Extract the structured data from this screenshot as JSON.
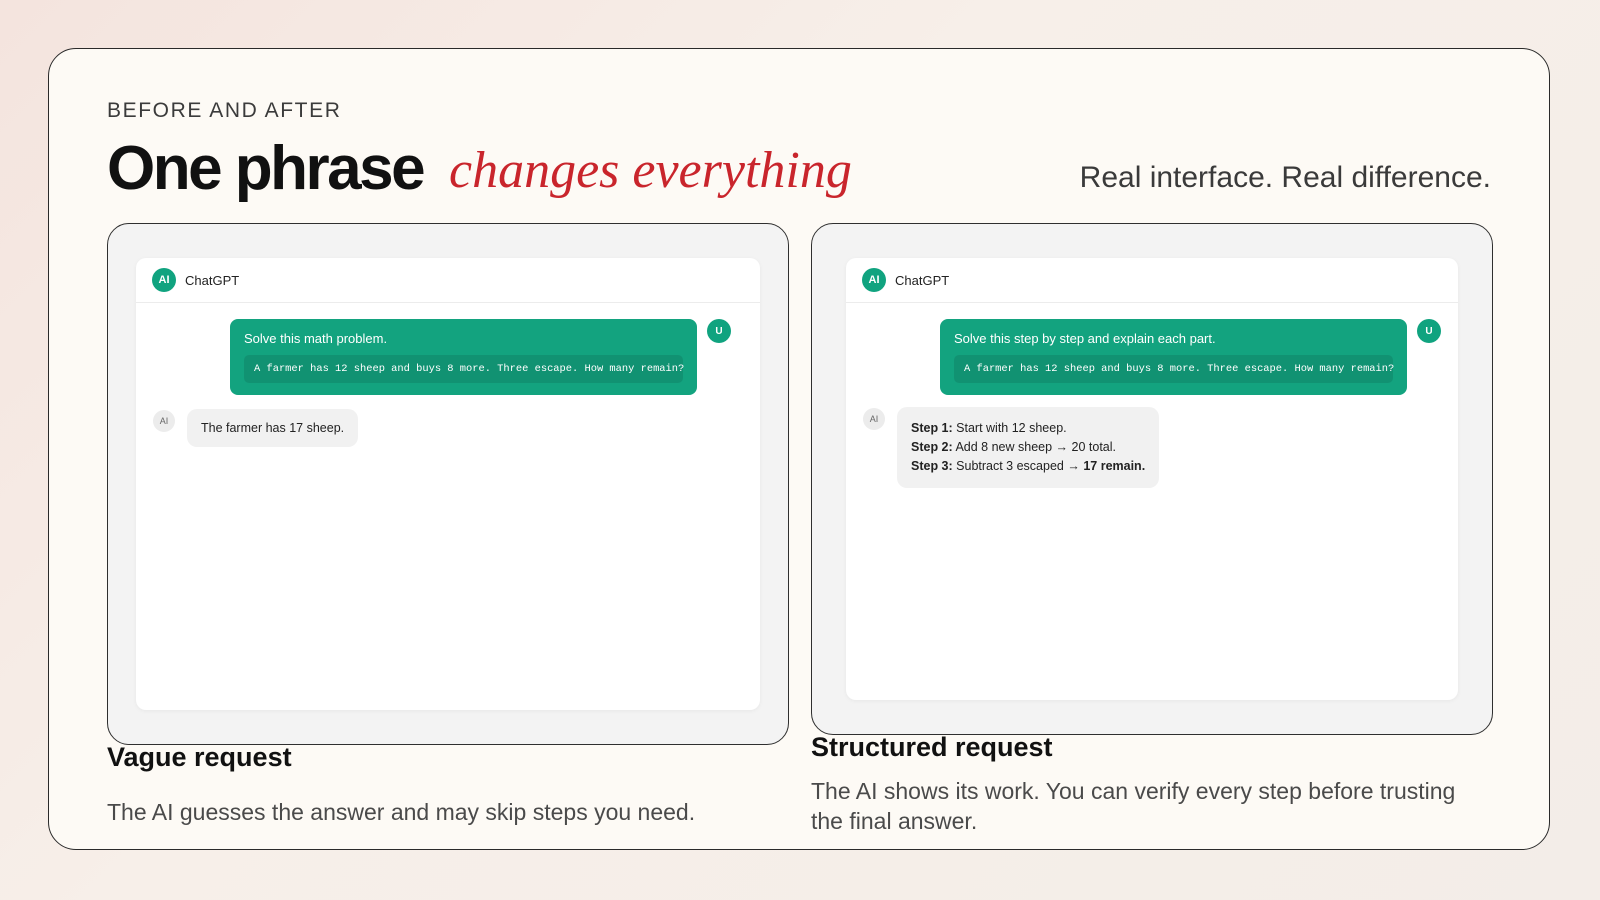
{
  "eyebrow": "BEFORE AND AFTER",
  "title": {
    "main": "One phrase",
    "accent": "changes everything",
    "subtitle": "Real interface. Real difference."
  },
  "colors": {
    "accent_red": "#c9252c",
    "brand_green": "#10a37f"
  },
  "left": {
    "chat_name": "ChatGPT",
    "ai_logo": "AI",
    "user_avatar": "U",
    "ai_avatar": "AI",
    "user_message": "Solve this math problem.",
    "user_code": "A farmer has 12 sheep and buys 8 more. Three escape. How many remain?",
    "ai_reply": "The farmer has 17 sheep.",
    "caption_title": "Vague request",
    "caption_text": "The AI guesses the answer and may skip steps you need."
  },
  "right": {
    "chat_name": "ChatGPT",
    "ai_logo": "AI",
    "user_avatar": "U",
    "ai_avatar": "AI",
    "user_message": "Solve this step by step and explain each part.",
    "user_code": "A farmer has 12 sheep and buys 8 more. Three escape. How many remain?",
    "steps": [
      {
        "label": "Step 1:",
        "text": " Start with 12 sheep.",
        "bold_tail": ""
      },
      {
        "label": "Step 2:",
        "text": " Add 8 new sheep → 20 total.",
        "bold_tail": ""
      },
      {
        "label": "Step 3:",
        "text": " Subtract 3 escaped → ",
        "bold_tail": "17 remain."
      }
    ],
    "caption_title": "Structured request",
    "caption_text": "The AI shows its work. You can verify every step before trusting the final answer."
  }
}
